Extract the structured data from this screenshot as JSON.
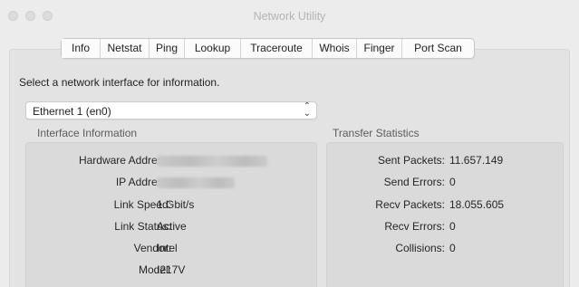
{
  "window": {
    "title": "Network Utility"
  },
  "tabs": [
    {
      "label": "Info"
    },
    {
      "label": "Netstat"
    },
    {
      "label": "Ping"
    },
    {
      "label": "Lookup"
    },
    {
      "label": "Traceroute"
    },
    {
      "label": "Whois"
    },
    {
      "label": "Finger"
    },
    {
      "label": "Port Scan"
    }
  ],
  "active_tab": "Info",
  "prompt": "Select a network interface for information.",
  "interface_select": {
    "selected": "Ethernet 1 (en0)"
  },
  "interface_info": {
    "heading": "Interface Information",
    "hardware_address": {
      "label": "Hardware Address:",
      "value": ""
    },
    "ip_address": {
      "label": "IP Address:",
      "value": ""
    },
    "link_speed": {
      "label": "Link Speed:",
      "value": "1 Gbit/s"
    },
    "link_status": {
      "label": "Link Status:",
      "value": "Active"
    },
    "vendor": {
      "label": "Vendor:",
      "value": "Intel"
    },
    "model": {
      "label": "Model:",
      "value": "I217V"
    }
  },
  "transfer_stats": {
    "heading": "Transfer Statistics",
    "sent_packets": {
      "label": "Sent Packets:",
      "value": "11.657.149"
    },
    "send_errors": {
      "label": "Send Errors:",
      "value": "0"
    },
    "recv_packets": {
      "label": "Recv Packets:",
      "value": "18.055.605"
    },
    "recv_errors": {
      "label": "Recv Errors:",
      "value": "0"
    },
    "collisions": {
      "label": "Collisions:",
      "value": "0"
    }
  }
}
